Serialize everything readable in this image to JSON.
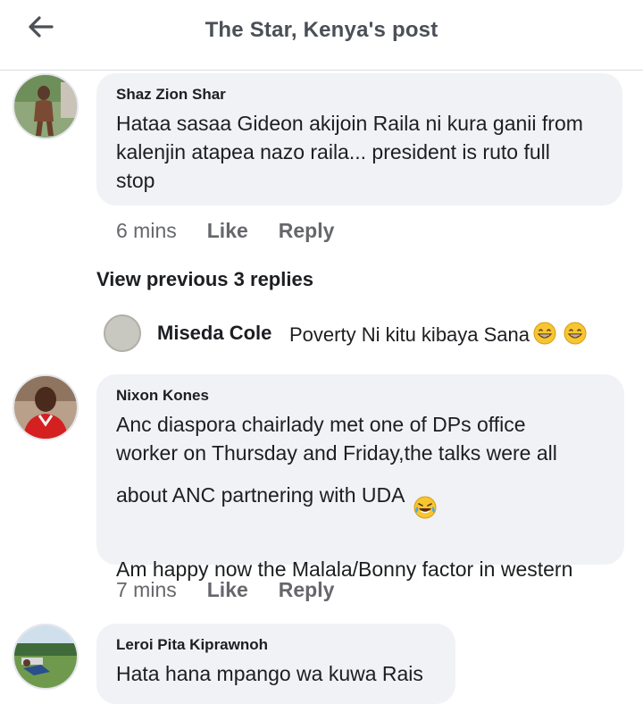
{
  "header": {
    "title": "The Star, Kenya's post"
  },
  "comments": [
    {
      "author": "Shaz Zion Shar",
      "text": "Hataa sasaa Gideon akijoin Raila ni kura ganii from\nkalenjin atapea nazo raila... president is ruto full\nstop",
      "time": "6 mins",
      "like": "Like",
      "reply": "Reply"
    },
    {
      "author": "Nixon Kones",
      "text": "Anc diaspora chairlady met one of DPs office\nworker on Thursday and Friday,the talks were all\nabout  ANC partnering with UDA",
      "text2": "Am happy now the Malala/Bonny factor in western",
      "time": "7 mins",
      "like": "Like",
      "reply": "Reply"
    },
    {
      "author": "Leroi Pita Kiprawnoh",
      "text": "Hata hana mpango wa kuwa Rais"
    }
  ],
  "view_previous": "View previous 3 replies",
  "reply": {
    "author": "Miseda Cole",
    "text": "Poverty Ni kitu kibaya Sana"
  },
  "icons": {
    "back": "back-arrow-icon",
    "emoji_grin": "grinning-emoji-icon",
    "emoji_laugh": "tears-of-joy-emoji-icon"
  }
}
